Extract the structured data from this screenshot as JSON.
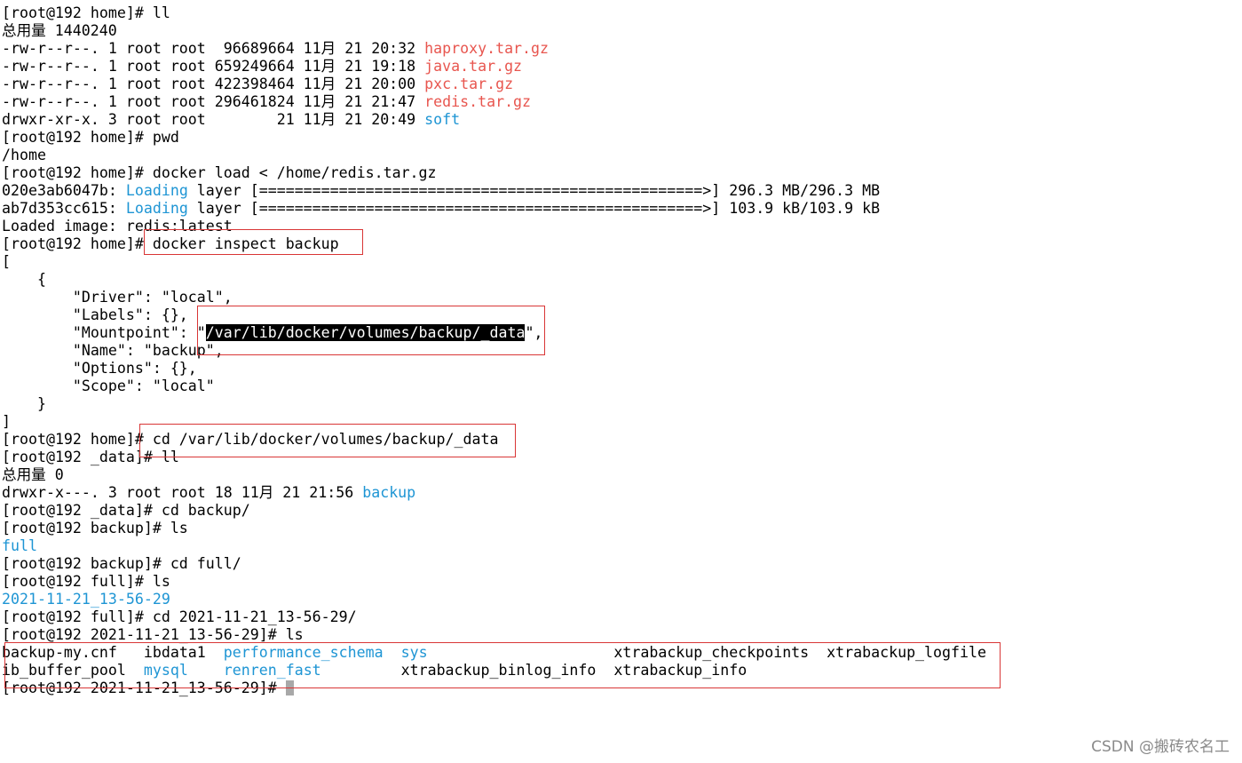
{
  "terminal": {
    "lines": [
      "[root@192 home]# ll",
      "总用量 1440240",
      {
        "meta": "-rw-r--r--. 1 root root  96689664 11月 21 20:32 ",
        "name": "haproxy.tar.gz"
      },
      {
        "meta": "-rw-r--r--. 1 root root 659249664 11月 21 19:18 ",
        "name": "java.tar.gz"
      },
      {
        "meta": "-rw-r--r--. 1 root root 422398464 11月 21 20:00 ",
        "name": "pxc.tar.gz"
      },
      {
        "meta": "-rw-r--r--. 1 root root 296461824 11月 21 21:47 ",
        "name": "redis.tar.gz"
      },
      {
        "meta": "drwxr-xr-x. 3 root root        21 11月 21 20:49 ",
        "name": "soft"
      },
      "[root@192 home]# pwd",
      "/home",
      "[root@192 home]# docker load < /home/redis.tar.gz",
      {
        "id": "020e3ab6047b: ",
        "status": "Loading",
        "rest": " layer [==================================================>] 296.3 MB/296.3 MB"
      },
      {
        "id": "ab7d353cc615: ",
        "status": "Loading",
        "rest": " layer [==================================================>] 103.9 kB/103.9 kB"
      },
      "Loaded image: redis:latest",
      "[root@192 home]# docker inspect backup",
      "[",
      "    {",
      "        \"Driver\": \"local\",",
      "        \"Labels\": {},",
      {
        "pre": "        \"Mountpoint\": \"",
        "selected": "/var/lib/docker/volumes/backup/_data",
        "post": "\","
      },
      "        \"Name\": \"backup\",",
      "        \"Options\": {},",
      "        \"Scope\": \"local\"",
      "    }",
      "]",
      "[root@192 home]# cd /var/lib/docker/volumes/backup/_data",
      "[root@192 _data]# ll",
      "总用量 0",
      {
        "meta": "drwxr-x---. 3 root root 18 11月 21 21:56 ",
        "name": "backup"
      },
      "[root@192 _data]# cd backup/",
      "[root@192 backup]# ls",
      "full",
      "[root@192 backup]# cd full/",
      "[root@192 full]# ls",
      "2021-11-21_13-56-29",
      "[root@192 full]# cd 2021-11-21_13-56-29/",
      "[root@192 2021-11-21_13-56-29]# ls",
      {
        "c1": "backup-my.cnf   ",
        "c2": "ibdata1  ",
        "c3": "performance_schema",
        "c4": "sys",
        "c5": "xtrabackup_checkpoints",
        "c6": "xtrabackup_logfile"
      },
      {
        "c1": "ib_buffer_pool  ",
        "c2": "mysql",
        "c3": "renren_fast",
        "c4": "xtrabackup_binlog_info",
        "c5": "xtrabackup_info"
      },
      "[root@192 2021-11-21_13-56-29]# "
    ]
  },
  "colors": {
    "background": "#ffffff",
    "text": "#000000",
    "directory": "#1e95d4",
    "archive": "#e8564f",
    "highlight_box": "#d93636",
    "cursor": "#a8a8a8"
  },
  "watermark": "CSDN @搬砖农名工"
}
